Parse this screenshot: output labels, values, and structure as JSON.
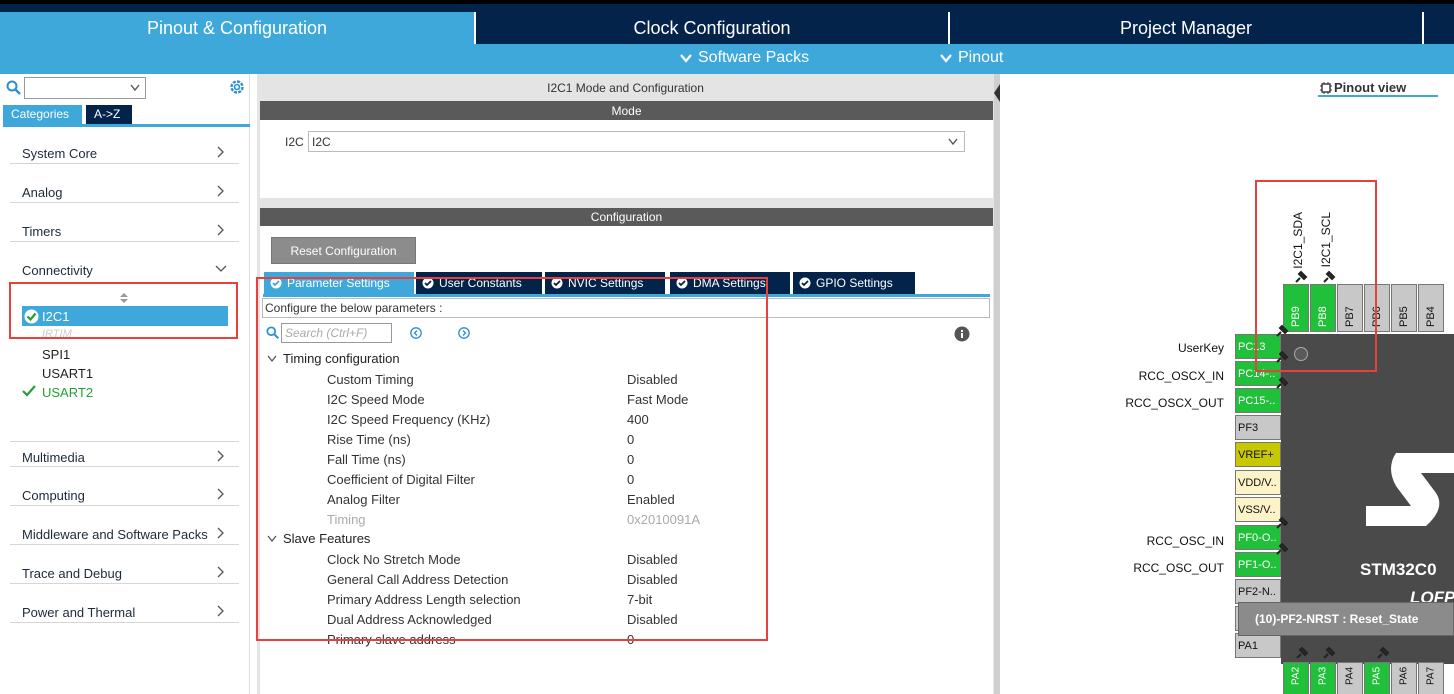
{
  "top_tabs": {
    "pinout": "Pinout & Configuration",
    "clock": "Clock Configuration",
    "project": "Project Manager"
  },
  "sub_menu": {
    "software_packs": "Software Packs",
    "pinout": "Pinout"
  },
  "left": {
    "tabs": {
      "categories": "Categories",
      "az": "A->Z"
    },
    "categories": [
      "System Core",
      "Analog",
      "Timers",
      "Connectivity",
      "Multimedia",
      "Computing",
      "Middleware and Software Packs",
      "Trace and Debug",
      "Power and Thermal"
    ],
    "connectivity_items": {
      "i2c1": "I2C1",
      "irtim": "IRTIM",
      "spi1": "SPI1",
      "usart1": "USART1",
      "usart2": "USART2"
    }
  },
  "middle": {
    "title": "I2C1 Mode and Configuration",
    "mode_header": "Mode",
    "mode_label": "I2C",
    "mode_value": "I2C",
    "config_header": "Configuration",
    "reset_button": "Reset Configuration",
    "tabs": [
      "Parameter Settings",
      "User Constants",
      "NVIC Settings",
      "DMA Settings",
      "GPIO Settings"
    ],
    "hint": "Configure the below parameters :",
    "search_placeholder": "Search (Ctrl+F)",
    "groups": {
      "timing": {
        "title": "Timing configuration",
        "params": [
          {
            "k": "Custom Timing",
            "v": "Disabled"
          },
          {
            "k": "I2C Speed Mode",
            "v": "Fast Mode"
          },
          {
            "k": "I2C Speed Frequency (KHz)",
            "v": "400"
          },
          {
            "k": "Rise Time (ns)",
            "v": "0"
          },
          {
            "k": "Fall Time (ns)",
            "v": "0"
          },
          {
            "k": "Coefficient of Digital Filter",
            "v": "0"
          },
          {
            "k": "Analog Filter",
            "v": "Enabled"
          },
          {
            "k": "Timing",
            "v": "0x2010091A"
          }
        ]
      },
      "slave": {
        "title": "Slave Features",
        "params": [
          {
            "k": "Clock No Stretch Mode",
            "v": "Disabled"
          },
          {
            "k": "General Call Address Detection",
            "v": "Disabled"
          },
          {
            "k": "Primary Address Length selection",
            "v": "7-bit"
          },
          {
            "k": "Dual Address Acknowledged",
            "v": "Disabled"
          },
          {
            "k": "Primary slave address",
            "v": "0"
          }
        ]
      }
    }
  },
  "right": {
    "pinout_view": "Pinout view",
    "top_pins": [
      "PB9",
      "PB8",
      "PB7",
      "PB6",
      "PB5",
      "PB4"
    ],
    "top_labels": [
      "I2C1_SDA",
      "I2C1_SCL"
    ],
    "left_pins": [
      "PC13",
      "PC14-..",
      "PC15-..",
      "PF3",
      "VREF+",
      "VDD/V..",
      "VSS/V..",
      "PF0-O..",
      "PF1-O..",
      "PF2-N..",
      "",
      "PA1"
    ],
    "left_labels": {
      "userkey": "UserKey",
      "osc32_in": "RCC_OSCX_IN",
      "osc32_out": "RCC_OSCX_OUT",
      "osc_in": "RCC_OSC_IN",
      "osc_out": "RCC_OSC_OUT"
    },
    "bottom_pins": [
      "PA2",
      "PA3",
      "PA4",
      "PA5",
      "PA6",
      "PA7"
    ],
    "chip_name": "STM32C0",
    "chip_package": "LQFP",
    "tooltip": "(10)-PF2-NRST : Reset_State"
  },
  "colors": {
    "accent": "#3ea8da",
    "navy": "#03234b",
    "pin_green": "#21c03a",
    "highlight_red": "#e8403c"
  }
}
